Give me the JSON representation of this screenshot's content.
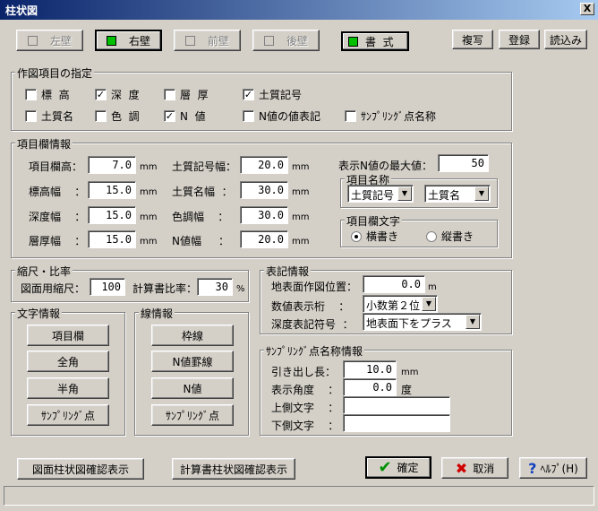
{
  "window": {
    "title": "柱状図",
    "close": "X"
  },
  "top": {
    "left_wall": "左壁",
    "right_wall": "右壁",
    "front_wall": "前壁",
    "back_wall": "後壁",
    "format": "書  式",
    "copy": "複写",
    "register": "登録",
    "load": "読込み"
  },
  "draw_items": {
    "legend": "作図項目の指定",
    "elevation": "標  高",
    "depth": "深  度",
    "layer_thickness": "層  厚",
    "soil_symbol": "土質記号",
    "soil_name": "土質名",
    "color_tone": "色  調",
    "n_value": "N  値",
    "n_value_label": "N値の値表記",
    "sampling_point_name": "ｻﾝﾌﾟﾘﾝｸﾞ点名称"
  },
  "column_info": {
    "legend": "項目欄情報",
    "item_height_label": "項目欄高：",
    "item_height": "7.0",
    "elev_width_label": "標高幅    ：",
    "elev_width": "15.0",
    "depth_width_label": "深度幅    ：",
    "depth_width": "15.0",
    "thick_width_label": "層厚幅    ：",
    "thick_width": "15.0",
    "soil_symbol_width_label": "土質記号幅：",
    "soil_symbol_width": "20.0",
    "soil_name_width_label": "土質名幅  ：",
    "soil_name_width": "30.0",
    "color_width_label": "色調幅    ：",
    "color_width": "30.0",
    "n_width_label": "N値幅     ：",
    "n_width": "20.0",
    "unit": "mm",
    "max_n_label": "表示N値の最大値：",
    "max_n": "50",
    "item_name_legend": "項目名称",
    "item_name_1": "土質記号",
    "item_name_2": "土質名",
    "item_text_legend": "項目欄文字",
    "horizontal": "横書き",
    "vertical": "縦書き"
  },
  "scale": {
    "legend": "縮尺・比率",
    "drawing_scale_label": "図面用縮尺：",
    "drawing_scale": "100",
    "calc_ratio_label": "計算書比率：",
    "calc_ratio": "30",
    "percent": "%"
  },
  "text_info": {
    "legend": "文字情報",
    "item_column": "項目欄",
    "full_width": "全角",
    "half_width": "半角",
    "sampling_point": "ｻﾝﾌﾟﾘﾝｸﾞ点"
  },
  "line_info": {
    "legend": "線情報",
    "frame_line": "枠線",
    "n_grid_line": "N値罫線",
    "n_value": "N値",
    "sampling_point": "ｻﾝﾌﾟﾘﾝｸﾞ点"
  },
  "notation": {
    "legend": "表記情報",
    "ground_pos_label": "地表面作図位置：",
    "ground_pos": "0.0",
    "ground_unit": "m",
    "digits_label": "数値表示桁    ：",
    "digits": "小数第２位",
    "depth_sign_label": "深度表記符号  ：",
    "depth_sign": "地表面下をプラス"
  },
  "sampling": {
    "legend": "ｻﾝﾌﾟﾘﾝｸﾞ点名称情報",
    "leader_label": "引き出し長：",
    "leader": "10.0",
    "leader_unit": "mm",
    "angle_label": "表示角度    ：",
    "angle": "0.0",
    "angle_unit": "度",
    "upper_label": "上側文字    ：",
    "upper": "",
    "lower_label": "下側文字    ：",
    "lower": ""
  },
  "bottom": {
    "drawing_confirm": "図面柱状図確認表示",
    "calc_confirm": "計算書柱状図確認表示",
    "ok": "確定",
    "cancel": "取消",
    "help": "ﾍﾙﾌﾟ(H)"
  },
  "colors": {
    "titlebar": "#0a246a",
    "led_on": "#00c000",
    "check": "#009000",
    "cancel_x": "#d00000",
    "help": "#1040c0"
  }
}
